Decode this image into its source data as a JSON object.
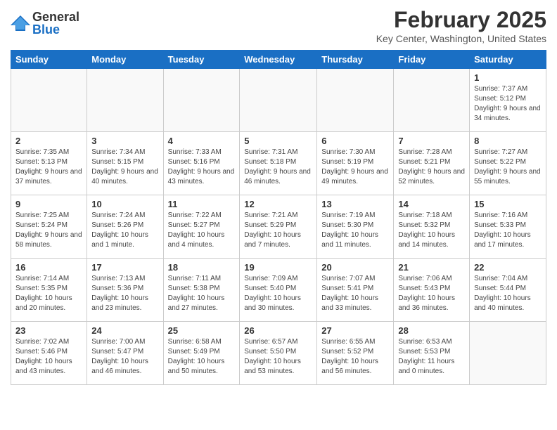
{
  "header": {
    "logo_general": "General",
    "logo_blue": "Blue",
    "month_title": "February 2025",
    "location": "Key Center, Washington, United States"
  },
  "days_of_week": [
    "Sunday",
    "Monday",
    "Tuesday",
    "Wednesday",
    "Thursday",
    "Friday",
    "Saturday"
  ],
  "weeks": [
    [
      {
        "day": "",
        "detail": ""
      },
      {
        "day": "",
        "detail": ""
      },
      {
        "day": "",
        "detail": ""
      },
      {
        "day": "",
        "detail": ""
      },
      {
        "day": "",
        "detail": ""
      },
      {
        "day": "",
        "detail": ""
      },
      {
        "day": "1",
        "detail": "Sunrise: 7:37 AM\nSunset: 5:12 PM\nDaylight: 9 hours and 34 minutes."
      }
    ],
    [
      {
        "day": "2",
        "detail": "Sunrise: 7:35 AM\nSunset: 5:13 PM\nDaylight: 9 hours and 37 minutes."
      },
      {
        "day": "3",
        "detail": "Sunrise: 7:34 AM\nSunset: 5:15 PM\nDaylight: 9 hours and 40 minutes."
      },
      {
        "day": "4",
        "detail": "Sunrise: 7:33 AM\nSunset: 5:16 PM\nDaylight: 9 hours and 43 minutes."
      },
      {
        "day": "5",
        "detail": "Sunrise: 7:31 AM\nSunset: 5:18 PM\nDaylight: 9 hours and 46 minutes."
      },
      {
        "day": "6",
        "detail": "Sunrise: 7:30 AM\nSunset: 5:19 PM\nDaylight: 9 hours and 49 minutes."
      },
      {
        "day": "7",
        "detail": "Sunrise: 7:28 AM\nSunset: 5:21 PM\nDaylight: 9 hours and 52 minutes."
      },
      {
        "day": "8",
        "detail": "Sunrise: 7:27 AM\nSunset: 5:22 PM\nDaylight: 9 hours and 55 minutes."
      }
    ],
    [
      {
        "day": "9",
        "detail": "Sunrise: 7:25 AM\nSunset: 5:24 PM\nDaylight: 9 hours and 58 minutes."
      },
      {
        "day": "10",
        "detail": "Sunrise: 7:24 AM\nSunset: 5:26 PM\nDaylight: 10 hours and 1 minute."
      },
      {
        "day": "11",
        "detail": "Sunrise: 7:22 AM\nSunset: 5:27 PM\nDaylight: 10 hours and 4 minutes."
      },
      {
        "day": "12",
        "detail": "Sunrise: 7:21 AM\nSunset: 5:29 PM\nDaylight: 10 hours and 7 minutes."
      },
      {
        "day": "13",
        "detail": "Sunrise: 7:19 AM\nSunset: 5:30 PM\nDaylight: 10 hours and 11 minutes."
      },
      {
        "day": "14",
        "detail": "Sunrise: 7:18 AM\nSunset: 5:32 PM\nDaylight: 10 hours and 14 minutes."
      },
      {
        "day": "15",
        "detail": "Sunrise: 7:16 AM\nSunset: 5:33 PM\nDaylight: 10 hours and 17 minutes."
      }
    ],
    [
      {
        "day": "16",
        "detail": "Sunrise: 7:14 AM\nSunset: 5:35 PM\nDaylight: 10 hours and 20 minutes."
      },
      {
        "day": "17",
        "detail": "Sunrise: 7:13 AM\nSunset: 5:36 PM\nDaylight: 10 hours and 23 minutes."
      },
      {
        "day": "18",
        "detail": "Sunrise: 7:11 AM\nSunset: 5:38 PM\nDaylight: 10 hours and 27 minutes."
      },
      {
        "day": "19",
        "detail": "Sunrise: 7:09 AM\nSunset: 5:40 PM\nDaylight: 10 hours and 30 minutes."
      },
      {
        "day": "20",
        "detail": "Sunrise: 7:07 AM\nSunset: 5:41 PM\nDaylight: 10 hours and 33 minutes."
      },
      {
        "day": "21",
        "detail": "Sunrise: 7:06 AM\nSunset: 5:43 PM\nDaylight: 10 hours and 36 minutes."
      },
      {
        "day": "22",
        "detail": "Sunrise: 7:04 AM\nSunset: 5:44 PM\nDaylight: 10 hours and 40 minutes."
      }
    ],
    [
      {
        "day": "23",
        "detail": "Sunrise: 7:02 AM\nSunset: 5:46 PM\nDaylight: 10 hours and 43 minutes."
      },
      {
        "day": "24",
        "detail": "Sunrise: 7:00 AM\nSunset: 5:47 PM\nDaylight: 10 hours and 46 minutes."
      },
      {
        "day": "25",
        "detail": "Sunrise: 6:58 AM\nSunset: 5:49 PM\nDaylight: 10 hours and 50 minutes."
      },
      {
        "day": "26",
        "detail": "Sunrise: 6:57 AM\nSunset: 5:50 PM\nDaylight: 10 hours and 53 minutes."
      },
      {
        "day": "27",
        "detail": "Sunrise: 6:55 AM\nSunset: 5:52 PM\nDaylight: 10 hours and 56 minutes."
      },
      {
        "day": "28",
        "detail": "Sunrise: 6:53 AM\nSunset: 5:53 PM\nDaylight: 11 hours and 0 minutes."
      },
      {
        "day": "",
        "detail": ""
      }
    ]
  ]
}
